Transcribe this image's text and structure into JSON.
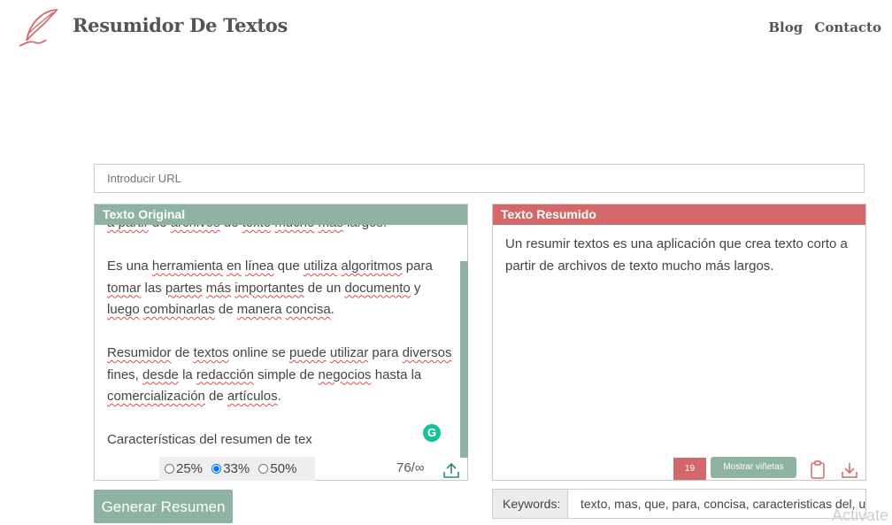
{
  "header": {
    "brand": "Resumidor De Textos",
    "nav": [
      "Blog",
      "Contacto"
    ]
  },
  "url_input": {
    "placeholder": "Introducir URL"
  },
  "original": {
    "title": "Texto Original",
    "partial_line": "a partir de archivos de texto mucho más largos.",
    "paragraph2": "Es una herramienta en línea que utiliza algoritmos para tomar las partes más importantes de un documento y luego combinarlas de manera concisa.",
    "paragraph3": "Resumidor de textos online se puede utilizar para diversos fines, desde la redacción simple de negocios hasta la comercialización de artículos.",
    "paragraph4": "Características del resumen de tex",
    "ratios": [
      {
        "label": "25%",
        "selected": false
      },
      {
        "label": "33%",
        "selected": true
      },
      {
        "label": "50%",
        "selected": false
      }
    ],
    "counter": "76/∞"
  },
  "summary": {
    "title": "Texto Resumido",
    "text": "Un resumir textos es una aplicación que crea texto corto a partir de archivos de texto mucho más largos.",
    "count_badge": "19",
    "bullets_button": "Mostrar viñetas"
  },
  "generate_button": "Generar Resumen",
  "keywords": {
    "label": "Keywords:",
    "value": "texto, mas, que, para, concisa, caracteristicas del, un"
  },
  "watermark": "Activate",
  "colors": {
    "green": "#8fb3a3",
    "red": "#d46769",
    "grammarly": "#15c39a"
  },
  "icons": [
    "quill-feather-icon",
    "grammarly-icon",
    "upload-icon",
    "clipboard-icon",
    "download-icon"
  ]
}
